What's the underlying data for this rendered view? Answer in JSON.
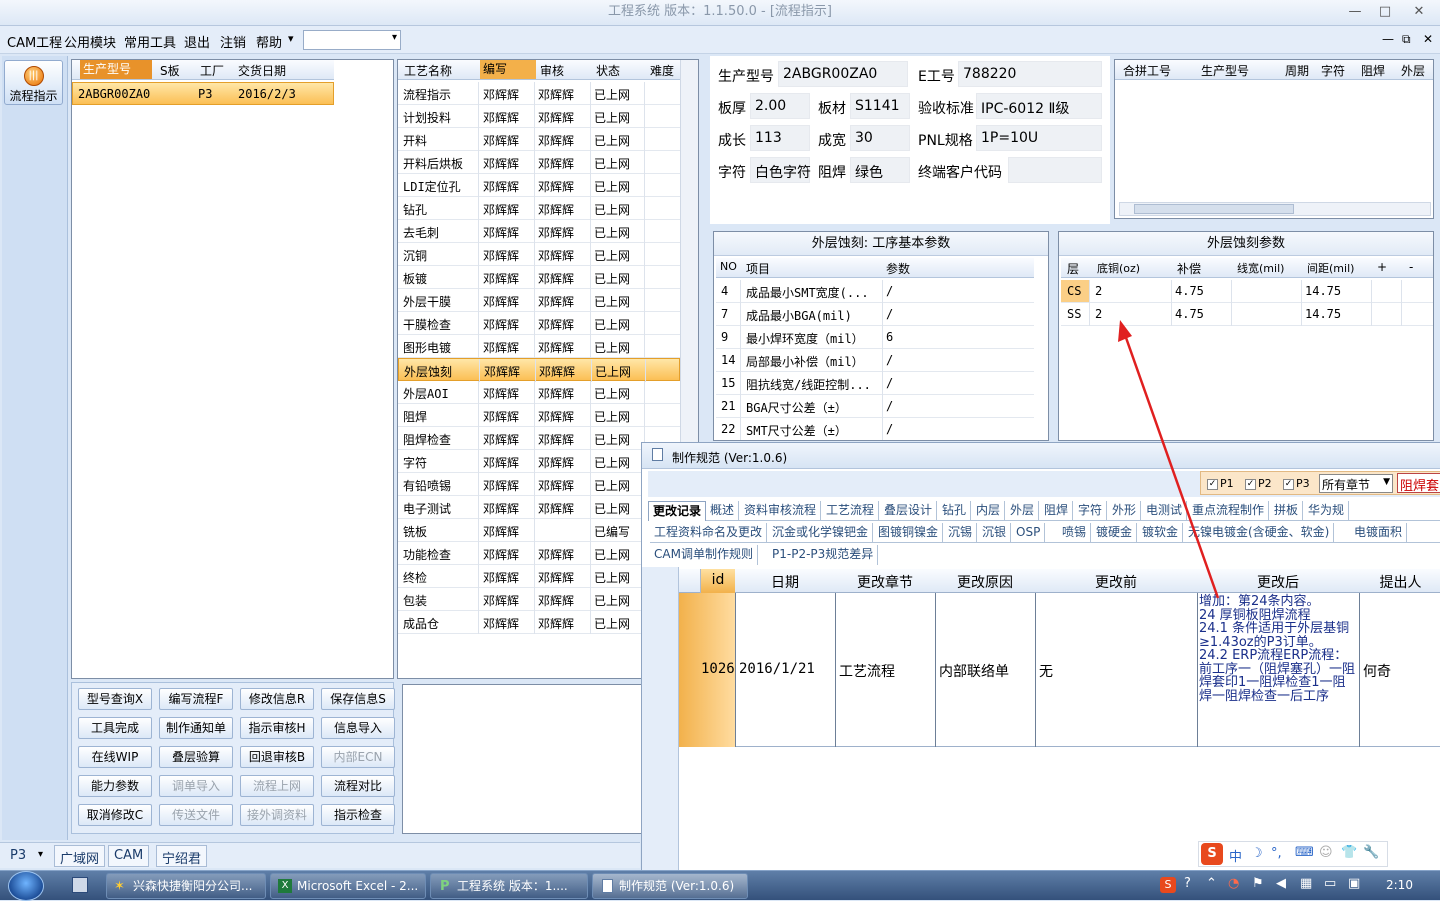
{
  "window": {
    "title": "工程系统   版本：1.1.50.0 - [流程指示]",
    "min": "—",
    "max": "□",
    "close": "✕"
  },
  "menu": {
    "items": [
      "CAM工程",
      "公用模块",
      "常用工具",
      "退出",
      "注销",
      "帮助"
    ],
    "help_arrow": "▾",
    "combo_arrow": "▾",
    "doc_min": "—",
    "doc_restore": "⧉",
    "doc_close": "✕"
  },
  "sidebar": {
    "flow_button": "流程指示"
  },
  "orders": {
    "headers": [
      "生产型号",
      "S板",
      "工厂",
      "交货日期"
    ],
    "rows": [
      {
        "model": "2ABGR00ZA0",
        "s": "",
        "factory": "P3",
        "date": "2016/2/3"
      }
    ]
  },
  "process": {
    "headers": [
      "工艺名称",
      "编写",
      "审核",
      "状态",
      "难度"
    ],
    "rows": [
      {
        "name": "流程指示",
        "writer": "邓辉辉",
        "reviewer": "邓辉辉",
        "status": "已上网"
      },
      {
        "name": "计划投料",
        "writer": "邓辉辉",
        "reviewer": "邓辉辉",
        "status": "已上网"
      },
      {
        "name": "开料",
        "writer": "邓辉辉",
        "reviewer": "邓辉辉",
        "status": "已上网"
      },
      {
        "name": "开料后烘板",
        "writer": "邓辉辉",
        "reviewer": "邓辉辉",
        "status": "已上网"
      },
      {
        "name": "LDI定位孔",
        "writer": "邓辉辉",
        "reviewer": "邓辉辉",
        "status": "已上网"
      },
      {
        "name": "钻孔",
        "writer": "邓辉辉",
        "reviewer": "邓辉辉",
        "status": "已上网"
      },
      {
        "name": "去毛刺",
        "writer": "邓辉辉",
        "reviewer": "邓辉辉",
        "status": "已上网"
      },
      {
        "name": "沉铜",
        "writer": "邓辉辉",
        "reviewer": "邓辉辉",
        "status": "已上网"
      },
      {
        "name": "板镀",
        "writer": "邓辉辉",
        "reviewer": "邓辉辉",
        "status": "已上网"
      },
      {
        "name": "外层干膜",
        "writer": "邓辉辉",
        "reviewer": "邓辉辉",
        "status": "已上网"
      },
      {
        "name": "干膜检查",
        "writer": "邓辉辉",
        "reviewer": "邓辉辉",
        "status": "已上网"
      },
      {
        "name": "图形电镀",
        "writer": "邓辉辉",
        "reviewer": "邓辉辉",
        "status": "已上网"
      },
      {
        "name": "外层蚀刻",
        "writer": "邓辉辉",
        "reviewer": "邓辉辉",
        "status": "已上网"
      },
      {
        "name": "外层AOI",
        "writer": "邓辉辉",
        "reviewer": "邓辉辉",
        "status": "已上网"
      },
      {
        "name": "阻焊",
        "writer": "邓辉辉",
        "reviewer": "邓辉辉",
        "status": "已上网"
      },
      {
        "name": "阻焊检查",
        "writer": "邓辉辉",
        "reviewer": "邓辉辉",
        "status": "已上网"
      },
      {
        "name": "字符",
        "writer": "邓辉辉",
        "reviewer": "邓辉辉",
        "status": "已上网"
      },
      {
        "name": "有铅喷锡",
        "writer": "邓辉辉",
        "reviewer": "邓辉辉",
        "status": "已上网"
      },
      {
        "name": "电子测试",
        "writer": "邓辉辉",
        "reviewer": "邓辉辉",
        "status": "已上网"
      },
      {
        "name": "铣板",
        "writer": "邓辉辉",
        "reviewer": "",
        "status": "已编写"
      },
      {
        "name": "功能检查",
        "writer": "邓辉辉",
        "reviewer": "邓辉辉",
        "status": "已上网"
      },
      {
        "name": "终检",
        "writer": "邓辉辉",
        "reviewer": "邓辉辉",
        "status": "已上网"
      },
      {
        "name": "包装",
        "writer": "邓辉辉",
        "reviewer": "邓辉辉",
        "status": "已上网"
      },
      {
        "name": "成品仓",
        "writer": "邓辉辉",
        "reviewer": "邓辉辉",
        "status": "已上网"
      }
    ]
  },
  "info": {
    "model_label": "生产型号",
    "model": "2ABGR00ZA0",
    "e_label": "E工号",
    "e_no": "788220",
    "thick_label": "板厚",
    "thick": "2.00",
    "mat_label": "板材",
    "mat": "S1141",
    "std_label": "验收标准",
    "std": "IPC-6012 Ⅱ级",
    "len_label": "成长",
    "len": "113",
    "wid_label": "成宽",
    "wid": "30",
    "pnl_label": "PNL规格",
    "pnl": "1P=10U",
    "char_label": "字符",
    "char": "白色字符",
    "mask_label": "阻焊",
    "mask": "绿色",
    "cust_label": "终端客户代码",
    "cust": ""
  },
  "merge": {
    "headers": [
      "合拼工号",
      "生产型号",
      "周期",
      "字符",
      "阻焊",
      "外层"
    ]
  },
  "basic_params": {
    "title": "外层蚀刻: 工序基本参数",
    "headers": [
      "NO",
      "项目",
      "参数"
    ],
    "rows": [
      {
        "no": "4",
        "item": "成品最小SMT宽度(...",
        "val": "/"
      },
      {
        "no": "7",
        "item": "成品最小BGA(mil)",
        "val": "/"
      },
      {
        "no": "9",
        "item": "最小焊环宽度（mil）",
        "val": "6"
      },
      {
        "no": "14",
        "item": "局部最小补偿（mil）",
        "val": "/"
      },
      {
        "no": "15",
        "item": "阻抗线宽/线距控制...",
        "val": "/"
      },
      {
        "no": "21",
        "item": "BGA尺寸公差（±）",
        "val": "/"
      },
      {
        "no": "22",
        "item": "SMT尺寸公差（±）",
        "val": "/"
      }
    ]
  },
  "etch_params": {
    "title": "外层蚀刻参数",
    "headers": [
      "层",
      "底铜(oz)",
      "补偿",
      "线宽(mil)",
      "间距(mil)",
      "+",
      "-"
    ],
    "rows": [
      {
        "layer": "CS",
        "cu": "2",
        "comp": "4.75",
        "width": "",
        "space": "14.75"
      },
      {
        "layer": "SS",
        "cu": "2",
        "comp": "4.75",
        "width": "",
        "space": "14.75"
      }
    ]
  },
  "buttons": [
    [
      "型号查询X",
      "编写流程F",
      "修改信息R",
      "保存信息S"
    ],
    [
      "工具完成",
      "制作通知单",
      "指示审核H",
      "信息导入"
    ],
    [
      "在线WIP",
      "叠层验算",
      "回退审核B",
      "内部ECN"
    ],
    [
      "能力参数",
      "调单导入",
      "流程上网",
      "流程对比"
    ],
    [
      "取消修改C",
      "传送文件",
      "接外调资料",
      "指示检查"
    ]
  ],
  "disabled_buttons": [
    "内部ECN",
    "调单导入",
    "流程上网",
    "传送文件",
    "接外调资料"
  ],
  "status": {
    "plant": "P3",
    "tabs": [
      "广域网",
      "CAM",
      "宁绍君"
    ]
  },
  "spec": {
    "title": "制作规范 (Ver:1.0.6)",
    "p1": "P1",
    "p2": "P2",
    "p3": "P3",
    "chapter": "所有章节",
    "search": "阻焊套",
    "tabs1": [
      "更改记录",
      "概述",
      "资料审核流程",
      "工艺流程",
      "叠层设计",
      "钻孔",
      "内层",
      "外层",
      "阻焊",
      "字符",
      "外形",
      "电测试",
      "重点流程制作",
      "拼板",
      "华为规"
    ],
    "tabs2": [
      "工程资料命名及更改",
      "沉金或化学镍钯金",
      "图镀铜镍金",
      "沉锡",
      "沉银",
      "OSP",
      "喷锡",
      "镀硬金",
      "镀软金",
      "无镍电镀金(含硬金、软金)",
      "电镀面积"
    ],
    "tabs3": [
      "CAM调单制作规则",
      "P1-P2-P3规范差异"
    ],
    "headers": [
      "id",
      "日期",
      "更改章节",
      "更改原因",
      "更改前",
      "更改后",
      "提出人"
    ],
    "record": {
      "id": "1026",
      "date": "2016/1/21",
      "chapter": "工艺流程",
      "reason": "内部联络单",
      "before": "无",
      "after": "增加：第24条内容。\n24 厚铜板阻焊流程\n24.1 条件适用于外层基铜≥1.43oz的P3订单。\n24.2 ERP流程ERP流程：前工序一（阻焊塞孔）一阻焊套印1一阻焊检查1一阻焊一阻焊检查一后工序",
      "person": "何奇"
    }
  },
  "ime": [
    "中",
    "☽",
    "°,",
    "⌨",
    "☺",
    "👕",
    "🔧"
  ],
  "taskbar": {
    "items": [
      "兴森快捷衡阳分公司...",
      "Microsoft Excel - 2...",
      "工程系统  版本：1....",
      "制作规范 (Ver:1.0.6)"
    ],
    "clock": "2:10"
  },
  "colors": {
    "selection": "#fbbf55",
    "arrow": "#e02020",
    "accent": "#2b4f7c"
  }
}
